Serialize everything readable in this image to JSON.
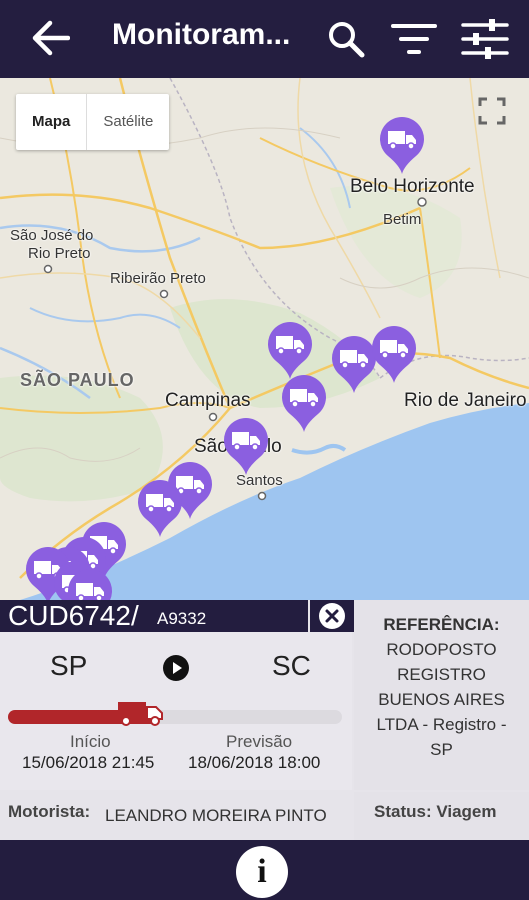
{
  "header": {
    "title": "Monitoram...",
    "icons": [
      "back-arrow-icon",
      "search-icon",
      "filter-icon",
      "sliders-icon"
    ]
  },
  "map": {
    "type_buttons": [
      "Mapa",
      "Satélite"
    ],
    "labels": {
      "belo_horizonte": "Belo Horizonte",
      "betim": "Betim",
      "sao_jose": "São José do",
      "rio_preto": "Rio Preto",
      "ribeirao": "Ribeirão Preto",
      "sao_paulo_state": "SÃO PAULO",
      "campinas": "Campinas",
      "sao_paulo": "São Paulo",
      "santos": "Santos",
      "rio": "Rio de Janeiro"
    },
    "pin_color": "#8b5fe0"
  },
  "vehicle": {
    "plate": "CUD6742/",
    "trailer": "A9332",
    "origin": "SP",
    "destination": "SC",
    "progress_percent": 45,
    "start_label": "Início",
    "start_date": "15/06/2018 21:45",
    "end_label": "Previsão",
    "end_date": "18/06/2018 18:00",
    "driver_label": "Motorista:",
    "driver_name": "LEANDRO MOREIRA PINTO",
    "status_text": "Status: Viagem"
  },
  "reference": {
    "title": "REFERÊNCIA:",
    "line1": "RODOPOSTO",
    "line2": "REGISTRO",
    "line3": "BUENOS AIRES",
    "line4": "LTDA - Registro -",
    "line5": "SP"
  },
  "colors": {
    "bar": "#241e40",
    "progress": "#b1262a",
    "pin": "#8b5fe0"
  }
}
